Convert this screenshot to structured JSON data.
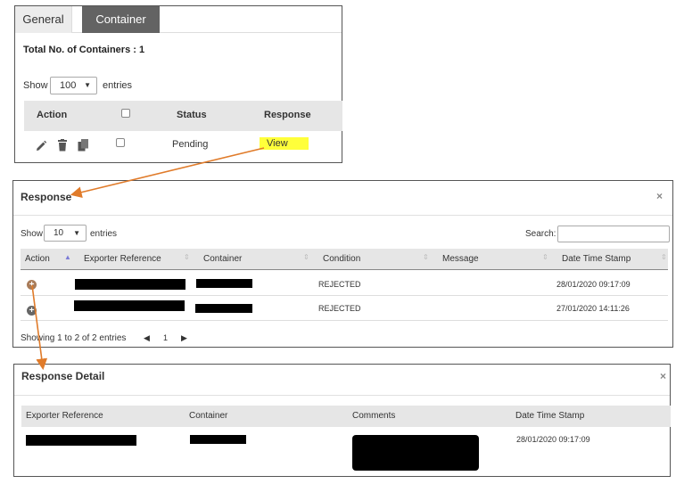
{
  "tabs": {
    "general": "General",
    "container": "Container"
  },
  "summary": {
    "total_label": "Total No. of Containers : 1"
  },
  "entries1": {
    "show": "Show",
    "value": "100",
    "entries": "entries"
  },
  "table1": {
    "headers": {
      "action": "Action",
      "status": "Status",
      "response": "Response"
    },
    "row": {
      "status": "Pending",
      "response_link": "View"
    }
  },
  "response_modal": {
    "title": "Response",
    "close": "×",
    "show": "Show",
    "entries_value": "10",
    "entries": "entries",
    "search_label": "Search:",
    "headers": {
      "action": "Action",
      "exporter_reference": "Exporter Reference",
      "container": "Container",
      "condition": "Condition",
      "message": "Message",
      "date_time_stamp": "Date Time Stamp"
    },
    "rows": [
      {
        "condition": "REJECTED",
        "timestamp": "28/01/2020 09:17:09"
      },
      {
        "condition": "REJECTED",
        "timestamp": "27/01/2020 14:11:26"
      }
    ],
    "footer": "Showing 1 to 2 of 2 entries",
    "pager": {
      "prev": "◀",
      "page": "1",
      "next": "▶"
    }
  },
  "detail_modal": {
    "title": "Response Detail",
    "close": "×",
    "headers": {
      "exporter_reference": "Exporter Reference",
      "container": "Container",
      "comments": "Comments",
      "date_time_stamp": "Date Time Stamp"
    },
    "row": {
      "timestamp": "28/01/2020 09:17:09"
    }
  },
  "colors": {
    "tab_active": "#636363",
    "header_bg": "#e6e6e6",
    "highlight": "#ffff3a",
    "arrow": "#e07b2a"
  }
}
